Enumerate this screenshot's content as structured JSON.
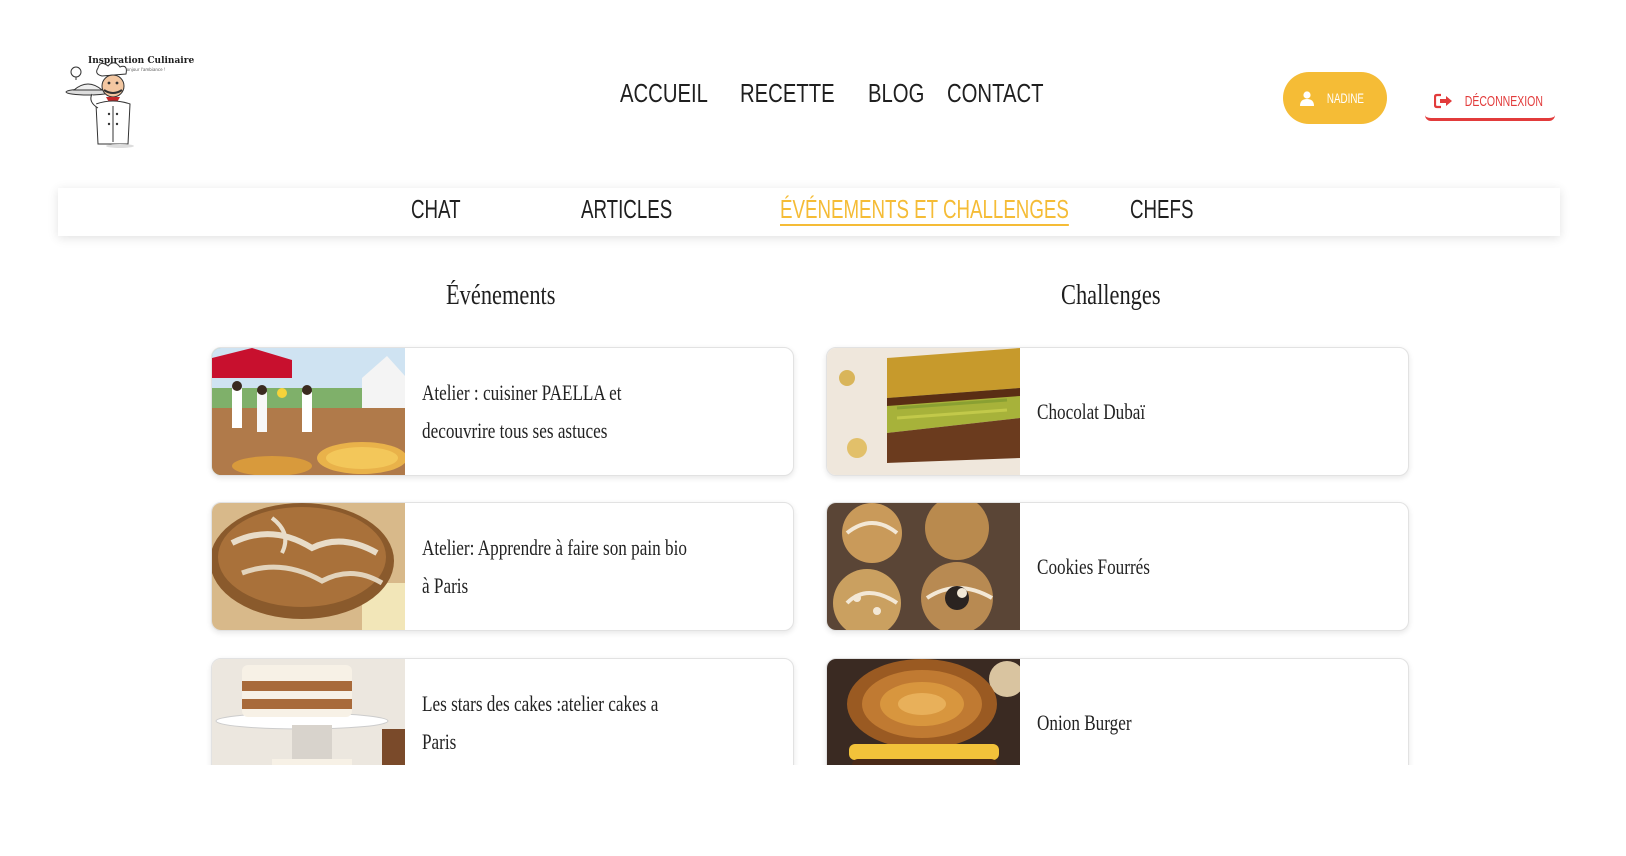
{
  "logo": {
    "title": "Inspiration Culinaire",
    "subtitle": "Bonjour l'ambiance !"
  },
  "nav": {
    "items": [
      "ACCUEIL",
      "RECETTE",
      "BLOG",
      "CONTACT"
    ]
  },
  "user": {
    "name": "NADINE",
    "logout": "DÉCONNEXION"
  },
  "tabs": [
    "CHAT",
    "ARTICLES",
    "ÉVÉNEMENTS ET CHALLENGES",
    "CHEFS"
  ],
  "active_tab": "ÉVÉNEMENTS ET CHALLENGES",
  "colors": {
    "accent": "#f5bc36",
    "logout": "#e23b3b"
  },
  "events": {
    "title": "Événements",
    "items": [
      {
        "label": "Atelier : cuisiner PAELLA et decouvrire tous ses astuces"
      },
      {
        "label": "Atelier: Apprendre à faire son pain bio à Paris"
      },
      {
        "label": "Les stars des cakes :atelier cakes a Paris"
      }
    ]
  },
  "challenges": {
    "title": "Challenges",
    "items": [
      {
        "label": "Chocolat Dubaï"
      },
      {
        "label": "Cookies Fourrés"
      },
      {
        "label": "Onion Burger"
      }
    ]
  }
}
